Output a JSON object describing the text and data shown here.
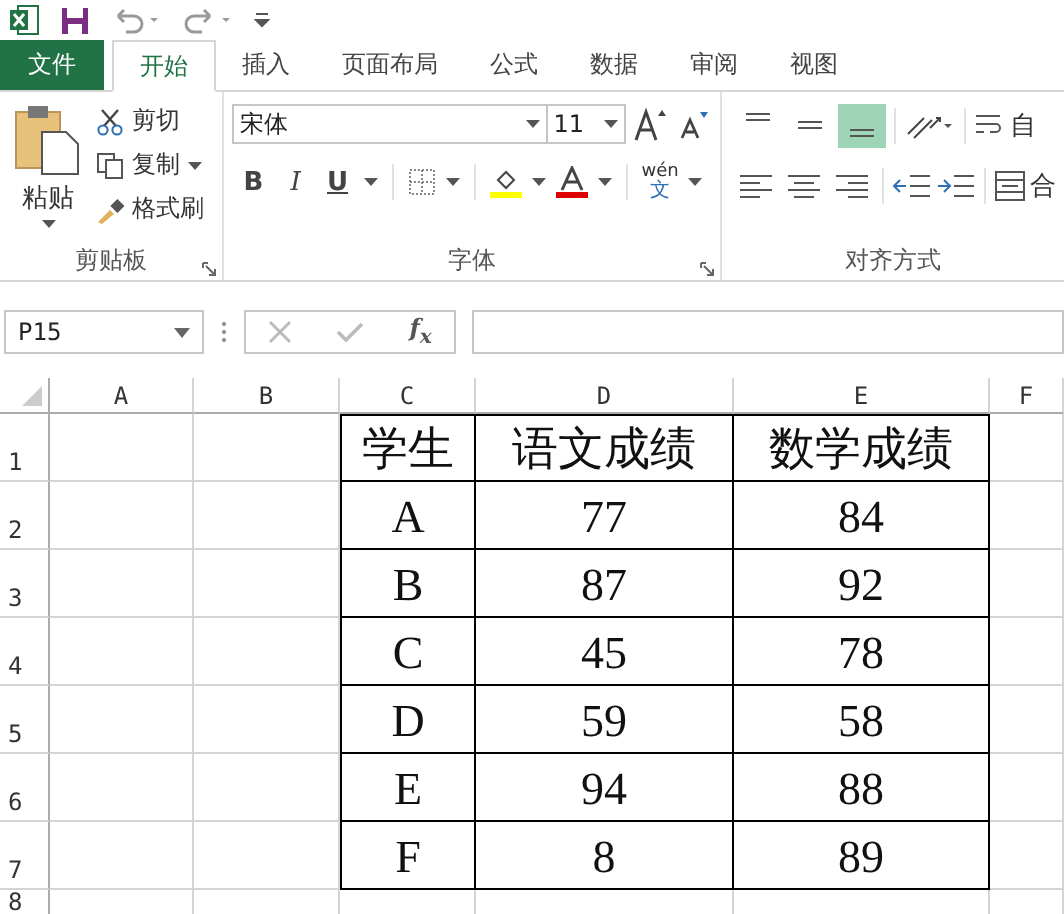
{
  "tabs": [
    {
      "label": "文件",
      "kind": "file",
      "selected": false
    },
    {
      "label": "开始",
      "kind": "tab",
      "selected": true
    },
    {
      "label": "插入",
      "kind": "tab",
      "selected": false
    },
    {
      "label": "页面布局",
      "kind": "tab",
      "selected": false
    },
    {
      "label": "公式",
      "kind": "tab",
      "selected": false
    },
    {
      "label": "数据",
      "kind": "tab",
      "selected": false
    },
    {
      "label": "审阅",
      "kind": "tab",
      "selected": false
    },
    {
      "label": "视图",
      "kind": "tab",
      "selected": false
    }
  ],
  "ribbon": {
    "clipboard": {
      "paste": "粘贴",
      "cut": "剪切",
      "copy": "复制",
      "format_painter": "格式刷",
      "label": "剪贴板"
    },
    "font": {
      "font_name": "宋体",
      "font_size": "11",
      "bold": "B",
      "italic": "I",
      "underline": "U",
      "phonetic_pinyin": "wén",
      "phonetic_char": "文",
      "label": "字体"
    },
    "alignment": {
      "vertical": [
        {
          "selected": false
        },
        {
          "selected": false
        },
        {
          "selected": true
        }
      ],
      "wrap_text": "自",
      "merge": "合",
      "label": "对齐方式"
    }
  },
  "formula_bar": {
    "name_box": "P15",
    "function": "f$_{x}$"
  },
  "sheet": {
    "columns": [
      "A",
      "B",
      "C",
      "D",
      "E",
      "F"
    ],
    "rows": [
      "1",
      "2",
      "3",
      "4",
      "5",
      "6",
      "7",
      "8"
    ],
    "table": [
      [
        "学生",
        "语文成绩",
        "数学成绩"
      ],
      [
        "A",
        "77",
        "84"
      ],
      [
        "B",
        "87",
        "92"
      ],
      [
        "C",
        "45",
        "78"
      ],
      [
        "D",
        "59",
        "58"
      ],
      [
        "E",
        "94",
        "88"
      ],
      [
        "F",
        "8",
        "89"
      ]
    ]
  }
}
